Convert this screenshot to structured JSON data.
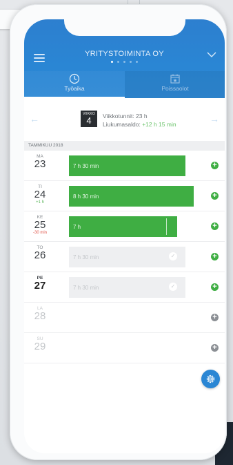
{
  "header": {
    "company": "YRITYSTOIMINTA OY",
    "page_dots": 5,
    "active_dot": 1
  },
  "tabs": [
    {
      "label": "Työaika",
      "icon": "clock-icon",
      "active": true
    },
    {
      "label": "Poissaolot",
      "icon": "calendar-icon",
      "active": false
    }
  ],
  "week": {
    "label": "VIIKKO",
    "number": "4",
    "hours_label": "Viikkotunnit: 23 h",
    "flex_label": "Liukumasaldo:",
    "flex_value": "+12 h 15 min"
  },
  "month_label": "TAMMIKUU 2018",
  "days": [
    {
      "name": "MA",
      "num": "23",
      "sub": "",
      "bar": "7 h 30 min"
    },
    {
      "name": "TI",
      "num": "24",
      "sub": "+1 h",
      "bar": "8 h 30 min"
    },
    {
      "name": "KE",
      "num": "25",
      "sub": "-30 min",
      "bar": "7 h"
    },
    {
      "name": "TO",
      "num": "26",
      "sub": "",
      "bar": "7 h 30 min"
    },
    {
      "name": "PE",
      "num": "27",
      "sub": "",
      "bar": "7 h 30 min"
    },
    {
      "name": "LA",
      "num": "28",
      "sub": "",
      "bar": ""
    },
    {
      "name": "SU",
      "num": "29",
      "sub": "",
      "bar": ""
    }
  ],
  "colors": {
    "header_blue": "#2a86d4",
    "bar_green": "#3fae43",
    "positive": "#6bc36b",
    "negative": "#e0554a"
  },
  "icons": {
    "menu": "hamburger-menu-icon",
    "dropdown": "chevron-down-icon",
    "prev": "arrow-left-icon",
    "next": "arrow-right-icon",
    "add": "plus-icon",
    "settings": "gear-icon",
    "done": "check-icon"
  }
}
